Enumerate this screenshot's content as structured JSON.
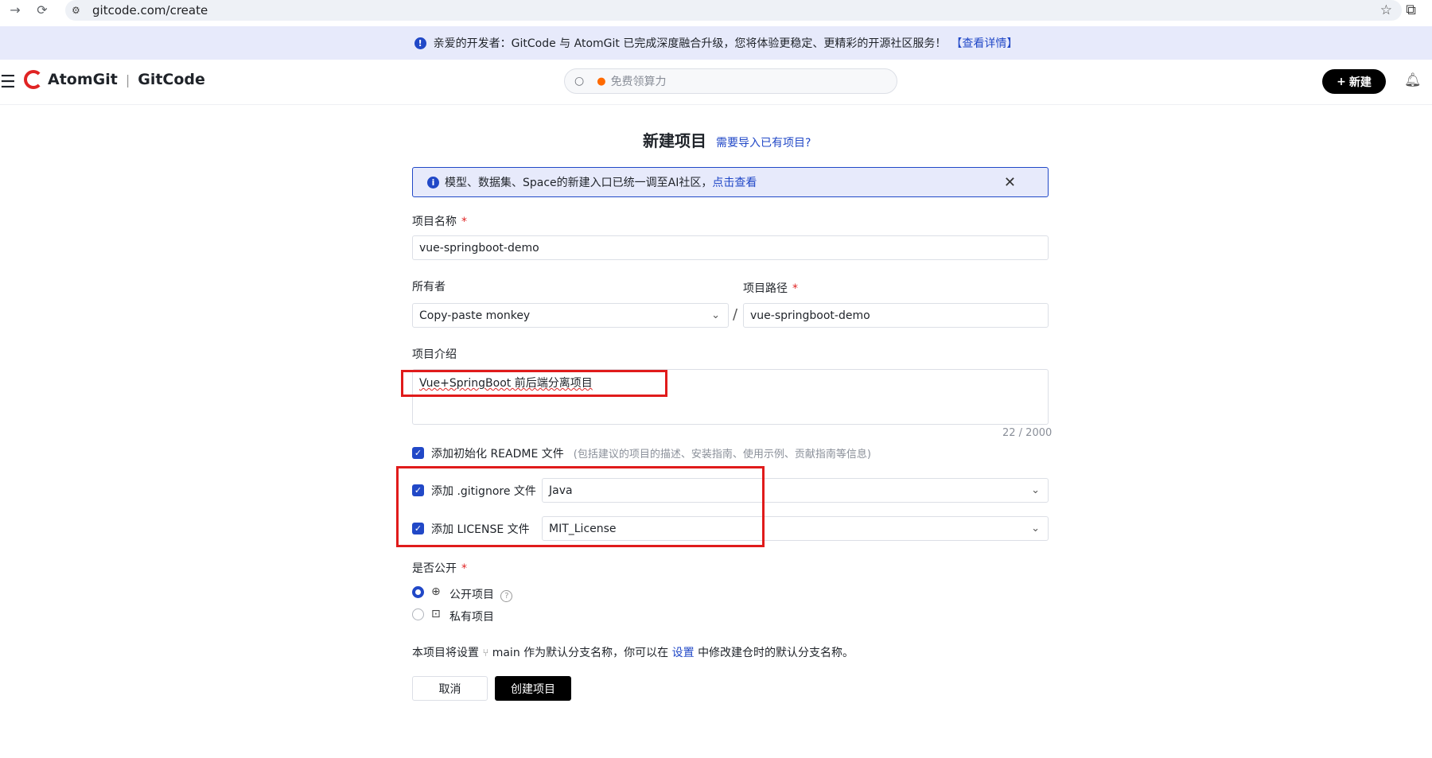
{
  "browser": {
    "back_icon": "→",
    "reload_icon": "⟳",
    "url": "gitcode.com/create"
  },
  "announcement": {
    "text": "亲爱的开发者：GitCode 与 AtomGit 已完成深度融合升级，您将体验更稳定、更精彩的开源社区服务！",
    "link": "【查看详情】"
  },
  "header": {
    "brand1": "AtomGit",
    "brand2": "GitCode",
    "search_placeholder": "免费领算力",
    "new_button": "新建"
  },
  "page": {
    "title": "新建项目",
    "import_link": "需要导入已有项目?",
    "notice_text": "模型、数据集、Space的新建入口已统一调至AI社区，",
    "notice_link": "点击查看"
  },
  "form": {
    "name_label": "项目名称",
    "name_value": "vue-springboot-demo",
    "owner_label": "所有者",
    "owner_value": "Copy-paste monkey",
    "path_label": "项目路径",
    "path_value": "vue-springboot-demo",
    "desc_label": "项目介绍",
    "desc_value": "Vue+SpringBoot 前后端分离项目",
    "desc_counter": "22 / 2000",
    "readme_label": "添加初始化 README 文件",
    "readme_hint": "(包括建议的项目的描述、安装指南、使用示例、贡献指南等信息)",
    "gitignore_label": "添加 .gitignore 文件",
    "gitignore_value": "Java",
    "license_label": "添加 LICENSE 文件",
    "license_value": "MIT_License",
    "visibility_label": "是否公开",
    "public_label": "公开项目",
    "private_label": "私有项目",
    "branch_info_prefix": "本项目将设置",
    "branch_name": "main",
    "branch_info_middle": "作为默认分支名称，你可以在",
    "settings_link": "设置",
    "branch_info_suffix": "中修改建仓时的默认分支名称。",
    "cancel_button": "取消",
    "create_button": "创建项目"
  },
  "colors": {
    "accent": "#2148c7",
    "banner_bg": "#e7eafb",
    "required": "#e02424",
    "highlight_box": "#e01b1b",
    "primary_button": "#000000"
  }
}
